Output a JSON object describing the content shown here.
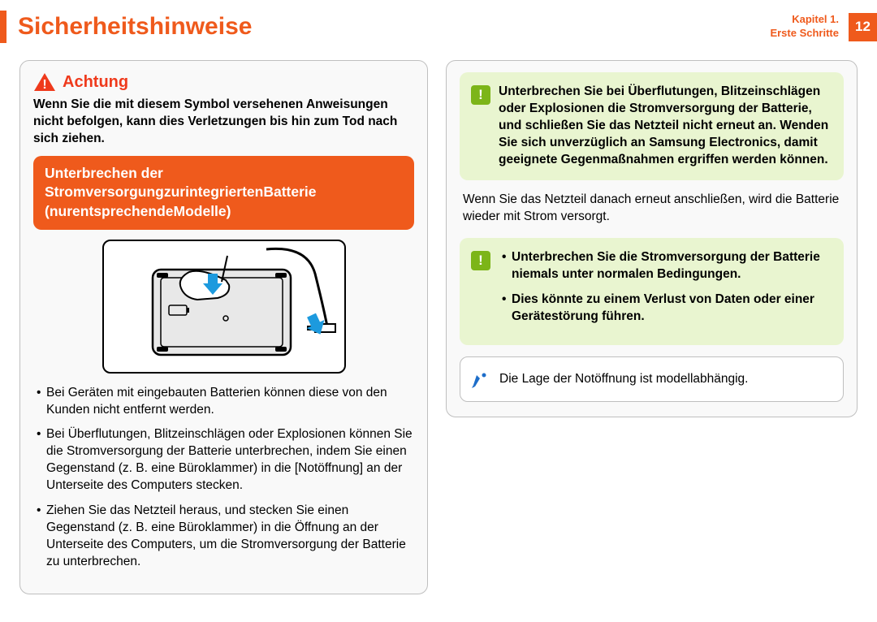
{
  "header": {
    "title": "Sicherheitshinweise",
    "chapter_line1": "Kapitel 1.",
    "chapter_line2": "Erste Schritte",
    "page_number": "12"
  },
  "left": {
    "attention_label": "Achtung",
    "attention_desc": "Wenn Sie die mit diesem Symbol versehenen Anweisungen nicht befolgen, kann dies Verletzungen bis hin zum Tod nach sich ziehen.",
    "banner_line1": "Unterbrechen der",
    "banner_line2": "StromversorgungzurintegriertenBatterie",
    "banner_line3": "(nurentsprechendeModelle)",
    "bullets": [
      "Bei Geräten mit eingebauten Batterien können diese von den Kunden nicht entfernt werden.",
      "Bei Überflutungen, Blitzeinschlägen oder Explosionen können Sie die Stromversorgung der Batterie unterbrechen, indem Sie einen Gegenstand (z. B. eine Büroklammer) in die [Notöffnung] an der Unterseite des Computers stecken.",
      "Ziehen Sie das Netzteil heraus, und stecken Sie einen Gegenstand (z. B. eine Büroklammer) in die Öffnung an der Unterseite des Computers, um die Stromversorgung der Batterie zu unterbrechen."
    ]
  },
  "right": {
    "green1_text": "Unterbrechen Sie bei Überflutungen, Blitzeinschlägen oder Explosionen die Stromversorgung der Batterie, und schließen Sie das Netzteil nicht erneut an. Wenden Sie sich unverzüglich an Samsung Electronics, damit geeignete Gegenmaßnahmen ergriffen werden können.",
    "plain": "Wenn Sie das Netzteil danach erneut anschließen, wird die Batterie wieder mit Strom versorgt.",
    "green2_bullets": [
      "Unterbrechen Sie die Stromversorgung der Batterie niemals unter normalen Bedingungen.",
      "Dies könnte zu einem Verlust von Daten oder einer Gerätestörung führen."
    ],
    "blue_note": "Die Lage der Notöffnung ist modellabhängig.",
    "exclaim": "!"
  }
}
